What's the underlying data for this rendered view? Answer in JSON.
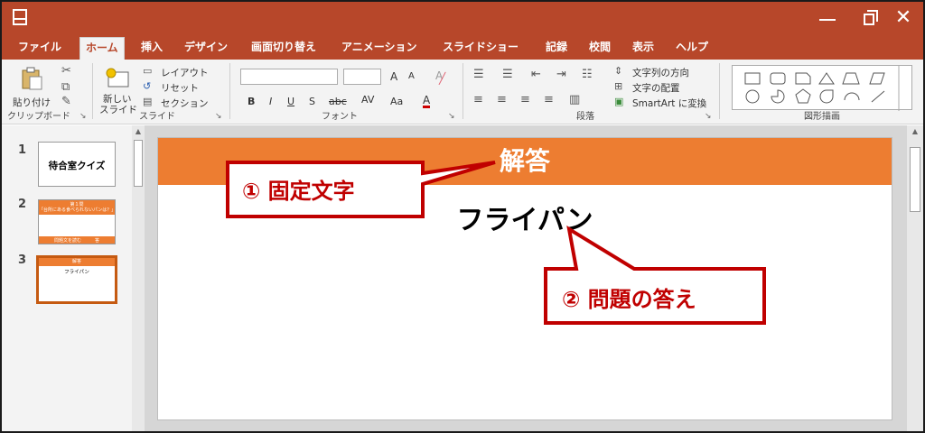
{
  "titlebar": {
    "close_glyph": "✕"
  },
  "tabs": [
    {
      "label": "ファイル",
      "active": false
    },
    {
      "label": "ホーム",
      "active": true
    },
    {
      "label": "挿入",
      "active": false
    },
    {
      "label": "デザイン",
      "active": false
    },
    {
      "label": "画面切り替え",
      "active": false
    },
    {
      "label": "アニメーション",
      "active": false
    },
    {
      "label": "スライドショー",
      "active": false
    },
    {
      "label": "記録",
      "active": false
    },
    {
      "label": "校閲",
      "active": false
    },
    {
      "label": "表示",
      "active": false
    },
    {
      "label": "ヘルプ",
      "active": false
    }
  ],
  "ribbon": {
    "clipboard": {
      "paste_label": "貼り付け",
      "group_label": "クリップボード"
    },
    "slides": {
      "new_slide_line1": "新しい",
      "new_slide_line2": "スライド",
      "layout_label": "レイアウト",
      "reset_label": "リセット",
      "section_label": "セクション",
      "group_label": "スライド"
    },
    "font": {
      "grow_label": "A",
      "shrink_label": "A",
      "bold": "B",
      "italic": "I",
      "underline": "U",
      "shadow": "S",
      "strike": "abc",
      "spacing": "AV",
      "case": "Aa",
      "color": "A",
      "group_label": "フォント"
    },
    "paragraph": {
      "text_direction": "文字列の方向",
      "align_text": "文字の配置",
      "smartart": "SmartArt に変換",
      "group_label": "段落"
    },
    "drawing": {
      "group_label": "図形描画"
    }
  },
  "thumbnails": [
    {
      "num": "1",
      "text": "待合室クイズ"
    },
    {
      "num": "2",
      "line1": "第１問",
      "line2": "「台所にある食べられないパンは？」",
      "footer": "問題文を読む　　　答"
    },
    {
      "num": "3",
      "title": "解答",
      "answer": "フライパン"
    }
  ],
  "slide": {
    "title": "解答",
    "answer": "フライパン"
  },
  "callouts": {
    "fixed": "① 固定文字",
    "answer": "② 問題の答え"
  },
  "colors": {
    "accent": "#b7472a",
    "slide_band": "#ed7d31",
    "callout": "#c00000"
  }
}
